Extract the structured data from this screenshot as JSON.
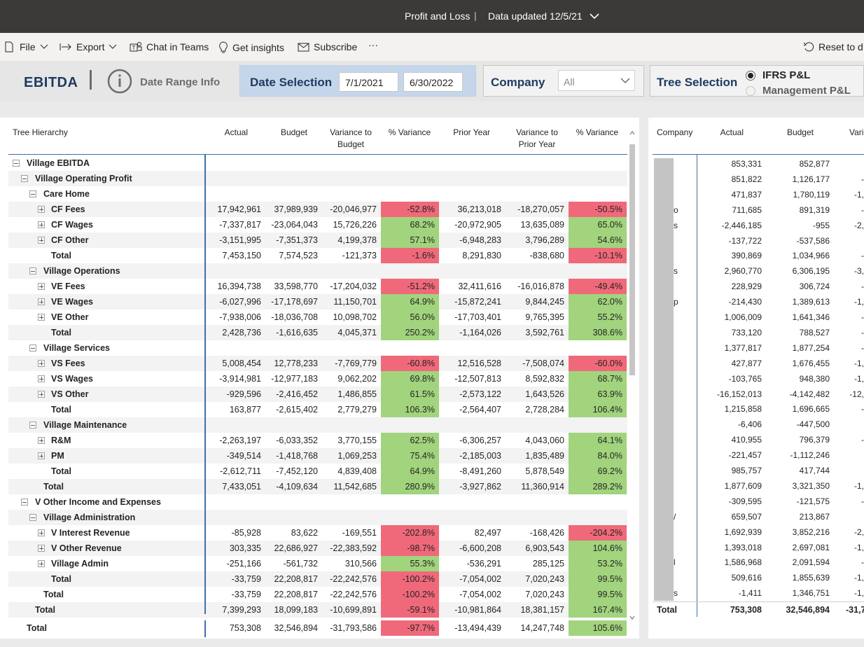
{
  "titlebar": {
    "report_title": "Profit and Loss",
    "separator": "|",
    "data_updated": "Data updated 12/5/21"
  },
  "toolbar": {
    "file": "File",
    "export": "Export",
    "chat": "Chat in Teams",
    "insights": "Get insights",
    "subscribe": "Subscribe",
    "more": "···",
    "reset": "Reset to d"
  },
  "filters": {
    "ebitda": "EBITDA",
    "date_range_info": "Date Range Info",
    "date_selection_label": "Date Selection",
    "date_start": "7/1/2021",
    "date_end": "6/30/2022",
    "company_label": "Company",
    "company_value": "All",
    "tree_label": "Tree Selection",
    "tree_options": [
      "IFRS P&L",
      "Management P&L"
    ],
    "tree_selected": "IFRS P&L"
  },
  "matrix": {
    "headers": {
      "hierarchy": "Tree Hierarchy",
      "actual": "Actual",
      "budget": "Budget",
      "var_budget_1": "Variance to",
      "var_budget_2": "Budget",
      "pct_var": "% Variance",
      "prior_year": "Prior Year",
      "var_py_1": "Variance to",
      "var_py_2": "Prior Year",
      "pct_var2": "% Variance"
    },
    "rows": [
      {
        "label": "Village EBITDA",
        "indent": 0,
        "expander": "minus"
      },
      {
        "label": "Village Operating Profit",
        "indent": 1,
        "expander": "minus"
      },
      {
        "label": "Care Home",
        "indent": 2,
        "expander": "minus"
      },
      {
        "label": "CF Fees",
        "indent": 3,
        "expander": "plus",
        "actual": "17,942,961",
        "budget": "37,989,939",
        "var_budget": "-20,046,977",
        "pct1": "-52.8%",
        "prior_year": "36,213,018",
        "var_py": "-18,270,057",
        "pct2": "-50.5%"
      },
      {
        "label": "CF Wages",
        "indent": 3,
        "expander": "plus",
        "actual": "-7,337,817",
        "budget": "-23,064,043",
        "var_budget": "15,726,226",
        "pct1": "68.2%",
        "prior_year": "-20,972,905",
        "var_py": "13,635,089",
        "pct2": "65.0%"
      },
      {
        "label": "CF Other",
        "indent": 3,
        "expander": "plus",
        "actual": "-3,151,995",
        "budget": "-7,351,373",
        "var_budget": "4,199,378",
        "pct1": "57.1%",
        "prior_year": "-6,948,283",
        "var_py": "3,796,289",
        "pct2": "54.6%"
      },
      {
        "label": "Total",
        "indent": 3,
        "expander": "",
        "actual": "7,453,150",
        "budget": "7,574,523",
        "var_budget": "-121,373",
        "pct1": "-1.6%",
        "prior_year": "8,291,830",
        "var_py": "-838,680",
        "pct2": "-10.1%"
      },
      {
        "label": "Village Operations",
        "indent": 2,
        "expander": "minus"
      },
      {
        "label": "VE Fees",
        "indent": 3,
        "expander": "plus",
        "actual": "16,394,738",
        "budget": "33,598,770",
        "var_budget": "-17,204,032",
        "pct1": "-51.2%",
        "prior_year": "32,411,616",
        "var_py": "-16,016,878",
        "pct2": "-49.4%"
      },
      {
        "label": "VE Wages",
        "indent": 3,
        "expander": "plus",
        "actual": "-6,027,996",
        "budget": "-17,178,697",
        "var_budget": "11,150,701",
        "pct1": "64.9%",
        "prior_year": "-15,872,241",
        "var_py": "9,844,245",
        "pct2": "62.0%"
      },
      {
        "label": "VE Other",
        "indent": 3,
        "expander": "plus",
        "actual": "-7,938,006",
        "budget": "-18,036,708",
        "var_budget": "10,098,702",
        "pct1": "56.0%",
        "prior_year": "-17,703,401",
        "var_py": "9,765,395",
        "pct2": "55.2%"
      },
      {
        "label": "Total",
        "indent": 3,
        "expander": "",
        "actual": "2,428,736",
        "budget": "-1,616,635",
        "var_budget": "4,045,371",
        "pct1": "250.2%",
        "prior_year": "-1,164,026",
        "var_py": "3,592,761",
        "pct2": "308.6%"
      },
      {
        "label": "Village Services",
        "indent": 2,
        "expander": "minus"
      },
      {
        "label": "VS Fees",
        "indent": 3,
        "expander": "plus",
        "actual": "5,008,454",
        "budget": "12,778,233",
        "var_budget": "-7,769,779",
        "pct1": "-60.8%",
        "prior_year": "12,516,528",
        "var_py": "-7,508,074",
        "pct2": "-60.0%"
      },
      {
        "label": "VS Wages",
        "indent": 3,
        "expander": "plus",
        "actual": "-3,914,981",
        "budget": "-12,977,183",
        "var_budget": "9,062,202",
        "pct1": "69.8%",
        "prior_year": "-12,507,813",
        "var_py": "8,592,832",
        "pct2": "68.7%"
      },
      {
        "label": "VS Other",
        "indent": 3,
        "expander": "plus",
        "actual": "-929,596",
        "budget": "-2,416,452",
        "var_budget": "1,486,855",
        "pct1": "61.5%",
        "prior_year": "-2,573,122",
        "var_py": "1,643,526",
        "pct2": "63.9%"
      },
      {
        "label": "Total",
        "indent": 3,
        "expander": "",
        "actual": "163,877",
        "budget": "-2,615,402",
        "var_budget": "2,779,279",
        "pct1": "106.3%",
        "prior_year": "-2,564,407",
        "var_py": "2,728,284",
        "pct2": "106.4%"
      },
      {
        "label": "Village Maintenance",
        "indent": 2,
        "expander": "minus"
      },
      {
        "label": "R&M",
        "indent": 3,
        "expander": "plus",
        "actual": "-2,263,197",
        "budget": "-6,033,352",
        "var_budget": "3,770,155",
        "pct1": "62.5%",
        "prior_year": "-6,306,257",
        "var_py": "4,043,060",
        "pct2": "64.1%"
      },
      {
        "label": "PM",
        "indent": 3,
        "expander": "plus",
        "actual": "-349,514",
        "budget": "-1,418,768",
        "var_budget": "1,069,253",
        "pct1": "75.4%",
        "prior_year": "-2,185,003",
        "var_py": "1,835,489",
        "pct2": "84.0%"
      },
      {
        "label": "Total",
        "indent": 3,
        "expander": "",
        "actual": "-2,612,711",
        "budget": "-7,452,120",
        "var_budget": "4,839,408",
        "pct1": "64.9%",
        "prior_year": "-8,491,260",
        "var_py": "5,878,549",
        "pct2": "69.2%"
      },
      {
        "label": "Total",
        "indent": 2,
        "expander": "",
        "actual": "7,433,051",
        "budget": "-4,109,634",
        "var_budget": "11,542,685",
        "pct1": "280.9%",
        "prior_year": "-3,927,862",
        "var_py": "11,360,914",
        "pct2": "289.2%"
      },
      {
        "label": "V Other Income and Expenses",
        "indent": 1,
        "expander": "minus"
      },
      {
        "label": "Village Administration",
        "indent": 2,
        "expander": "minus"
      },
      {
        "label": "V Interest Revenue",
        "indent": 3,
        "expander": "plus",
        "actual": "-85,928",
        "budget": "83,622",
        "var_budget": "-169,551",
        "pct1": "-202.8%",
        "prior_year": "82,497",
        "var_py": "-168,426",
        "pct2": "-204.2%"
      },
      {
        "label": "V Other Revenue",
        "indent": 3,
        "expander": "plus",
        "actual": "303,335",
        "budget": "22,686,927",
        "var_budget": "-22,383,592",
        "pct1": "-98.7%",
        "prior_year": "-6,600,208",
        "var_py": "6,903,543",
        "pct2": "104.6%"
      },
      {
        "label": "Village Admin",
        "indent": 3,
        "expander": "plus",
        "actual": "-251,166",
        "budget": "-561,732",
        "var_budget": "310,566",
        "pct1": "55.3%",
        "prior_year": "-536,291",
        "var_py": "285,125",
        "pct2": "53.2%"
      },
      {
        "label": "Total",
        "indent": 3,
        "expander": "",
        "actual": "-33,759",
        "budget": "22,208,817",
        "var_budget": "-22,242,576",
        "pct1": "-100.2%",
        "prior_year": "-7,054,002",
        "var_py": "7,020,243",
        "pct2": "99.5%"
      },
      {
        "label": "Total",
        "indent": 2,
        "expander": "",
        "actual": "-33,759",
        "budget": "22,208,817",
        "var_budget": "-22,242,576",
        "pct1": "-100.2%",
        "prior_year": "-7,054,002",
        "var_py": "7,020,243",
        "pct2": "99.5%"
      },
      {
        "label": "Total",
        "indent": 1,
        "expander": "",
        "actual": "7,399,293",
        "budget": "18,099,183",
        "var_budget": "-10,699,891",
        "pct1": "-59.1%",
        "prior_year": "-10,981,864",
        "var_py": "18,381,157",
        "pct2": "167.4%"
      }
    ],
    "grand_total": {
      "label": "Total",
      "actual": "753,308",
      "budget": "32,546,894",
      "var_budget": "-31,793,586",
      "pct1": "-97.7%",
      "prior_year": "-13,494,439",
      "var_py": "14,247,748",
      "pct2": "105.6%"
    }
  },
  "company_table": {
    "headers": {
      "company": "Company",
      "actual": "Actual",
      "budget": "Budget",
      "variance": "Vari"
    },
    "rows": [
      {
        "code": "",
        "actual": "853,331",
        "budget": "852,877",
        "variance": ""
      },
      {
        "code": "",
        "actual": "851,822",
        "budget": "1,126,177",
        "variance": "-"
      },
      {
        "code": "",
        "actual": "471,837",
        "budget": "1,780,119",
        "variance": "-1,"
      },
      {
        "code": "o",
        "actual": "711,685",
        "budget": "891,319",
        "variance": "-"
      },
      {
        "code": "s",
        "actual": "-2,446,185",
        "budget": "-955",
        "variance": "-2,"
      },
      {
        "code": "",
        "actual": "-137,722",
        "budget": "-537,586",
        "variance": ""
      },
      {
        "code": "",
        "actual": "390,869",
        "budget": "1,034,966",
        "variance": "-"
      },
      {
        "code": "s",
        "actual": "2,960,770",
        "budget": "6,306,195",
        "variance": "-3,"
      },
      {
        "code": "",
        "actual": "228,929",
        "budget": "306,724",
        "variance": "-"
      },
      {
        "code": "p",
        "actual": "-214,430",
        "budget": "1,389,613",
        "variance": "-1,"
      },
      {
        "code": "",
        "actual": "1,006,009",
        "budget": "1,641,346",
        "variance": "-"
      },
      {
        "code": "",
        "actual": "733,120",
        "budget": "788,527",
        "variance": "-"
      },
      {
        "code": "",
        "actual": "1,377,817",
        "budget": "1,877,254",
        "variance": "-"
      },
      {
        "code": "",
        "actual": "427,877",
        "budget": "1,676,455",
        "variance": "-1,"
      },
      {
        "code": "",
        "actual": "-103,765",
        "budget": "948,380",
        "variance": "-1,"
      },
      {
        "code": "",
        "actual": "-16,152,013",
        "budget": "-4,142,482",
        "variance": "-12,"
      },
      {
        "code": "",
        "actual": "1,215,858",
        "budget": "1,696,665",
        "variance": "-"
      },
      {
        "code": "",
        "actual": "-6,406",
        "budget": "-447,500",
        "variance": ""
      },
      {
        "code": "",
        "actual": "410,955",
        "budget": "796,379",
        "variance": "-"
      },
      {
        "code": "",
        "actual": "-221,457",
        "budget": "-1,112,246",
        "variance": ""
      },
      {
        "code": "",
        "actual": "985,757",
        "budget": "417,744",
        "variance": ""
      },
      {
        "code": "",
        "actual": "1,877,609",
        "budget": "3,321,350",
        "variance": "-1,"
      },
      {
        "code": "",
        "actual": "-309,595",
        "budget": "-121,575",
        "variance": "-"
      },
      {
        "code": "/",
        "actual": "659,507",
        "budget": "213,867",
        "variance": ""
      },
      {
        "code": "",
        "actual": "1,692,939",
        "budget": "3,852,216",
        "variance": "-2,"
      },
      {
        "code": "",
        "actual": "1,393,018",
        "budget": "2,697,081",
        "variance": "-1,"
      },
      {
        "code": "l",
        "actual": "1,586,968",
        "budget": "2,091,594",
        "variance": "-"
      },
      {
        "code": "",
        "actual": "509,616",
        "budget": "1,855,639",
        "variance": "-1,"
      },
      {
        "code": "s",
        "actual": "-1,411",
        "budget": "1,346,751",
        "variance": "-1,"
      }
    ],
    "total": {
      "label": "Total",
      "actual": "753,308",
      "budget": "32,546,894",
      "variance": "-31,7"
    }
  },
  "colors": {
    "positive": "#a1d47d",
    "negative": "#f0697a",
    "accent": "#1f3b63",
    "rule": "#3f6fa6"
  }
}
